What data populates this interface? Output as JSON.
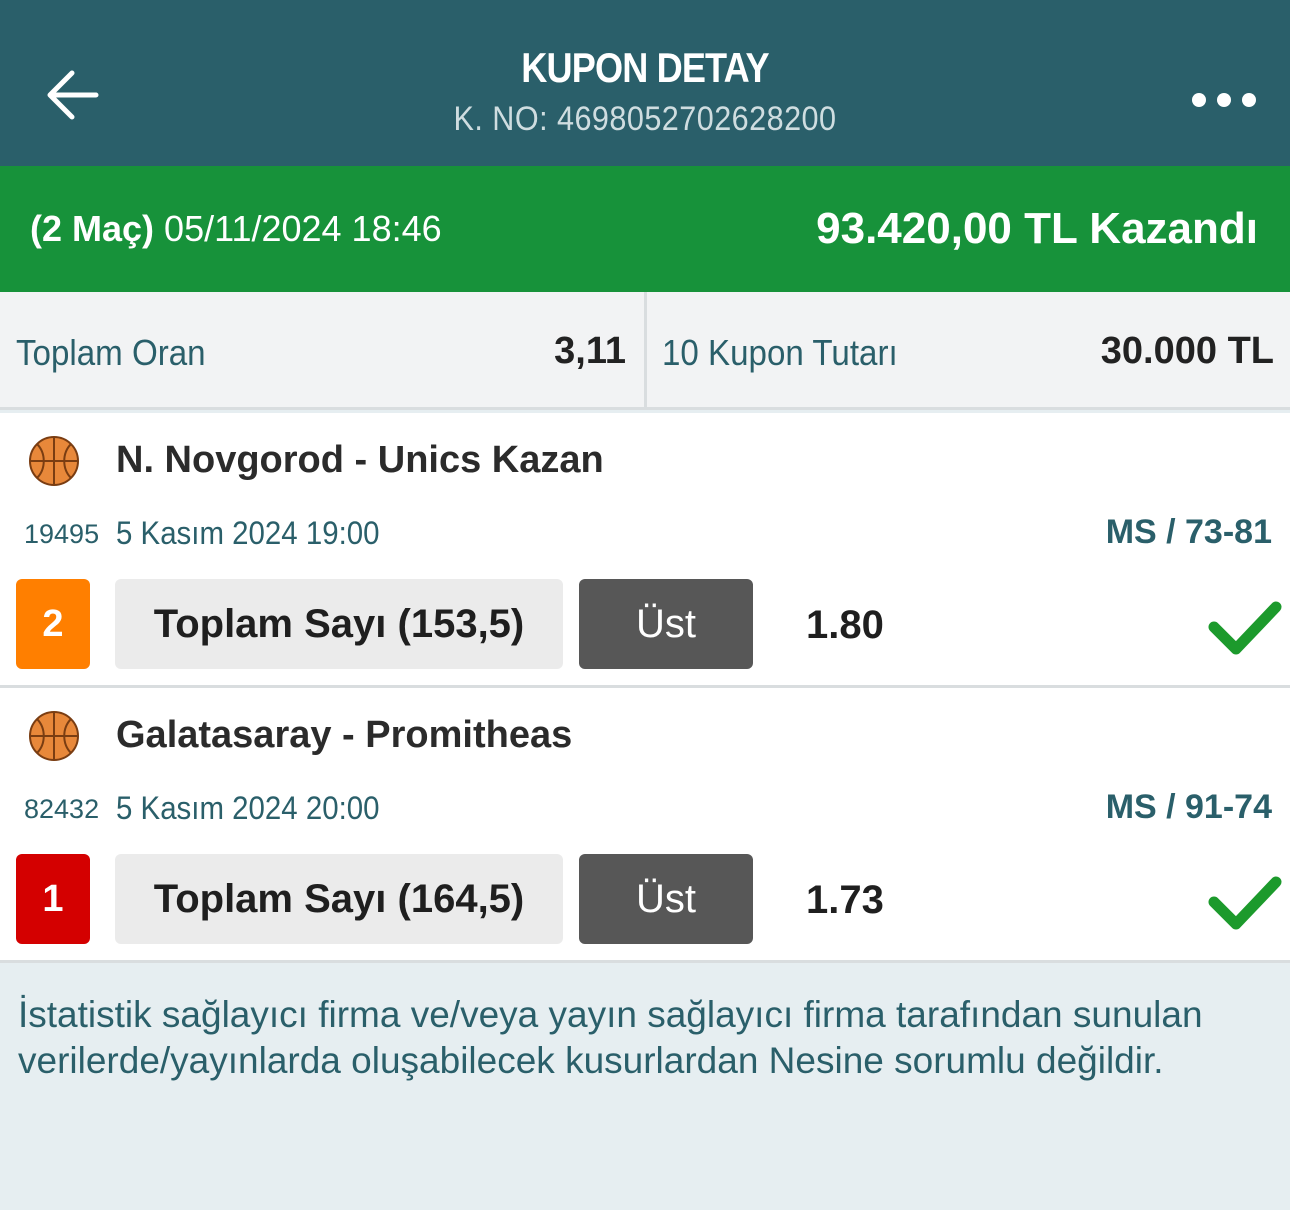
{
  "header": {
    "title": "KUPON DETAY",
    "subtitle": "K. NO: 4698052702628200",
    "back_icon": "arrow-left-icon",
    "more_icon": "more-horizontal-icon"
  },
  "result": {
    "match_count": "(2 Maç)",
    "datetime": "05/11/2024 18:46",
    "status": "93.420,00 TL Kazandı",
    "color": "#17923a"
  },
  "summary": {
    "total_odds_label": "Toplam Oran",
    "total_odds_value": "3,11",
    "stake_label": "10 Kupon Tutarı",
    "stake_value": "30.000 TL"
  },
  "matches": [
    {
      "sport_icon": "basketball-icon",
      "teams": "N. Novgorod - Unics Kazan",
      "code": "19495",
      "date": "5 Kasım 2024 19:00",
      "score": "MS / 73-81",
      "pick_number": "2",
      "badge_color": "#ff7f00",
      "market": "Toplam Sayı (153,5)",
      "selection": "Üst",
      "odd": "1.80",
      "result_icon": "check-icon"
    },
    {
      "sport_icon": "basketball-icon",
      "teams": "Galatasaray - Promitheas",
      "code": "82432",
      "date": "5 Kasım 2024 20:00",
      "score": "MS / 91-74",
      "pick_number": "1",
      "badge_color": "#d40000",
      "market": "Toplam Sayı (164,5)",
      "selection": "Üst",
      "odd": "1.73",
      "result_icon": "check-icon"
    }
  ],
  "disclaimer": "İstatistik sağlayıcı firma ve/veya yayın sağlayıcı firma tarafından sunulan verilerde/yayınlarda oluşabilecek kusurlardan Nesine sorumlu değildir."
}
